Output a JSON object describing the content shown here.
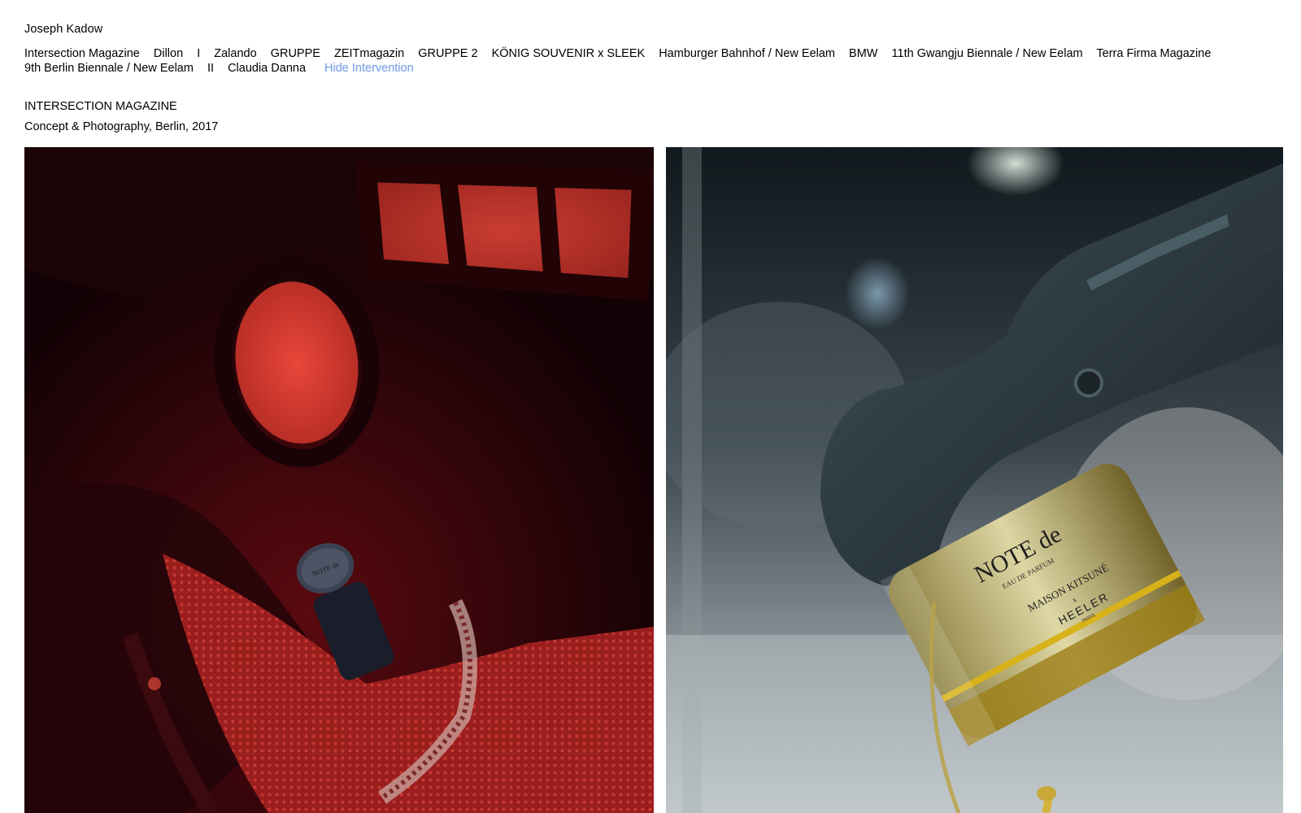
{
  "site": {
    "name": "Joseph Kadow"
  },
  "nav": {
    "items": [
      "Intersection Magazine",
      "Dillon",
      "I",
      "Zalando",
      "GRUPPE",
      "ZEITmagazin",
      "GRUPPE 2",
      "KÖNIG SOUVENIR x SLEEK",
      "Hamburger Bahnhof / New Eelam",
      "BMW",
      "11th Gwangju Biennale / New Eelam",
      "Terra Firma Magazine",
      "9th Berlin Biennale / New Eelam",
      "II",
      "Claudia Danna"
    ],
    "toggle_label": "Hide Intervention"
  },
  "project": {
    "title": "INTERSECTION MAGAZINE",
    "subtitle": "Concept & Photography, Berlin, 2017"
  },
  "photos": [
    {
      "label": "NOTE de",
      "color": "#8a1016"
    },
    {
      "label": "NOTE de",
      "sub": "EAU DE PARFUM",
      "maker": "MAISON KITSUNÉ",
      "cross": "x",
      "brand": "HEELER",
      "brand_sub": "PARIS",
      "color": "#c7b56a"
    }
  ]
}
